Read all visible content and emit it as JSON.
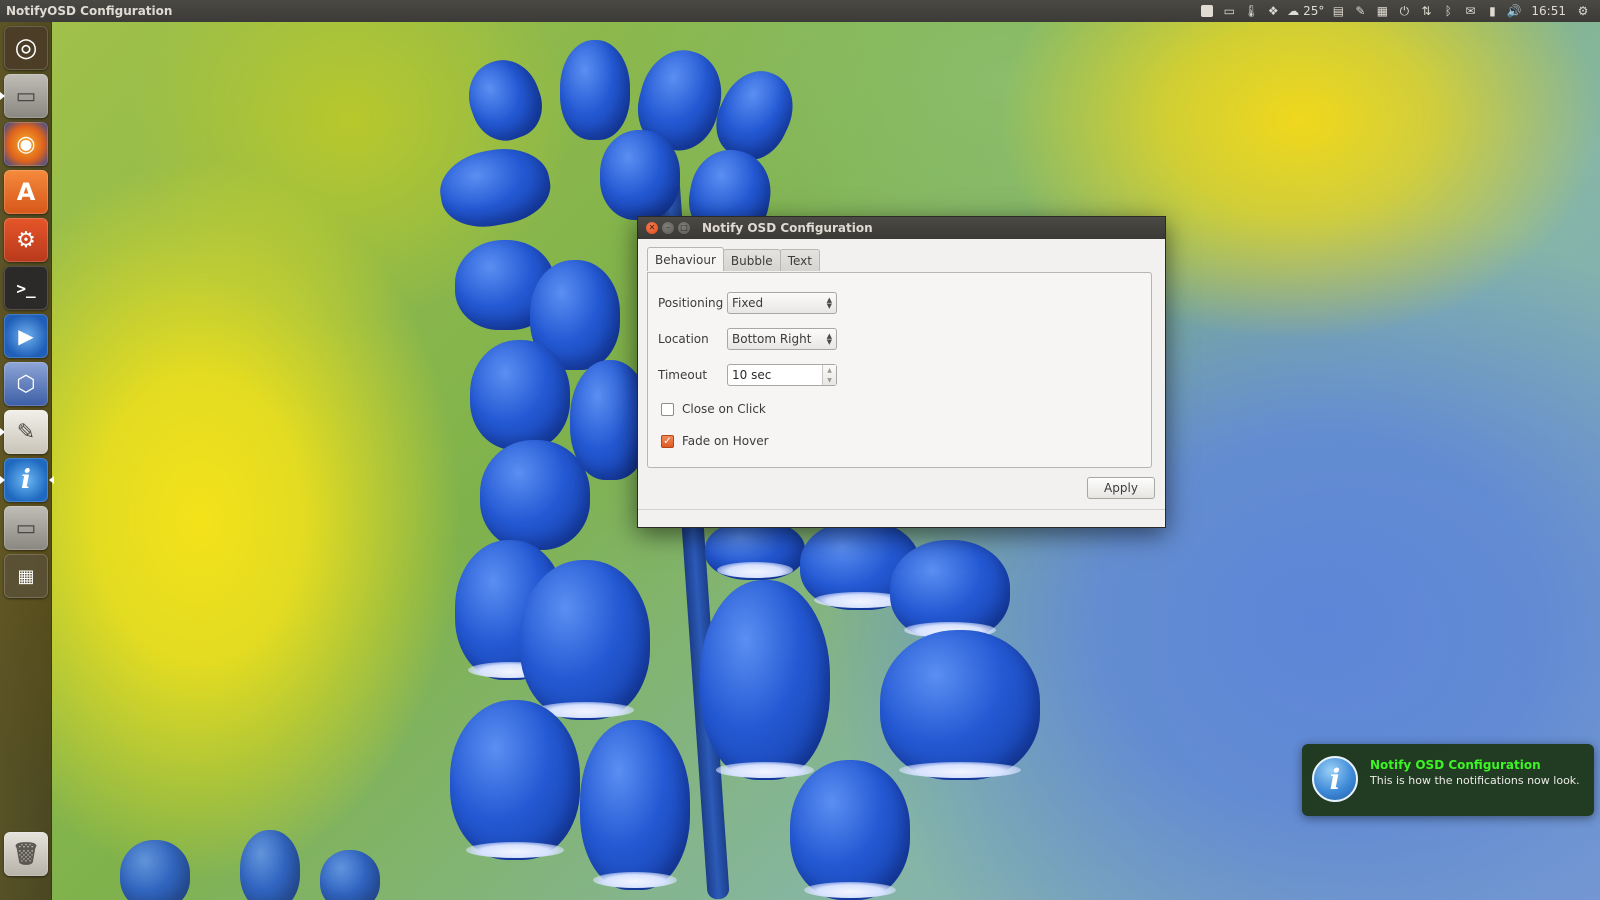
{
  "top_panel": {
    "app_title": "NotifyOSD Configuration",
    "indicators": [
      {
        "icon": "checkbox-indicator-icon"
      },
      {
        "icon": "keyboard-indicator-icon"
      },
      {
        "icon": "thermometer-icon"
      },
      {
        "icon": "dropbox-icon"
      },
      {
        "icon": "weather-icon",
        "label": "25°"
      },
      {
        "icon": "files-indicator-icon"
      },
      {
        "icon": "clipboard-icon"
      },
      {
        "icon": "calendar-icon"
      },
      {
        "icon": "power-indicator-icon"
      },
      {
        "icon": "network-icon"
      },
      {
        "icon": "bluetooth-icon"
      },
      {
        "icon": "mail-icon"
      },
      {
        "icon": "battery-icon"
      },
      {
        "icon": "volume-icon"
      }
    ],
    "clock": "16:51",
    "settings_icon": "gear-icon"
  },
  "launcher": {
    "items": [
      {
        "name": "dash-home",
        "icon": "ubuntu-logo-icon"
      },
      {
        "name": "file-manager",
        "icon": "drawer-icon"
      },
      {
        "name": "firefox",
        "icon": "firefox-icon"
      },
      {
        "name": "software-center",
        "icon": "software-center-icon"
      },
      {
        "name": "system-settings",
        "icon": "tools-icon"
      },
      {
        "name": "terminal",
        "icon": "terminal-icon",
        "glyph": ">_"
      },
      {
        "name": "media-player",
        "icon": "play-icon"
      },
      {
        "name": "virtualbox",
        "icon": "cube-icon"
      },
      {
        "name": "text-editor",
        "icon": "text-editor-icon"
      },
      {
        "name": "notify-osd-config",
        "icon": "info-icon"
      },
      {
        "name": "file-manager-2",
        "icon": "drawer-icon"
      },
      {
        "name": "workspace-switcher",
        "icon": "workspace-icon"
      },
      {
        "name": "trash",
        "icon": "trash-icon"
      }
    ]
  },
  "window": {
    "title": "Notify OSD Configuration",
    "tabs": [
      {
        "label": "Behaviour",
        "active": true
      },
      {
        "label": "Bubble",
        "active": false
      },
      {
        "label": "Text",
        "active": false
      }
    ],
    "positioning": {
      "label": "Positioning",
      "value": "Fixed"
    },
    "location": {
      "label": "Location",
      "value": "Bottom Right"
    },
    "timeout": {
      "label": "Timeout",
      "value": "10 sec"
    },
    "close_on_click": {
      "label": "Close on Click",
      "checked": false
    },
    "fade_on_hover": {
      "label": "Fade on Hover",
      "checked": true
    },
    "apply_label": "Apply"
  },
  "notification": {
    "title": "Notify OSD Configuration",
    "body": "This is how the notifications now look.",
    "icon": "info-icon"
  },
  "colors": {
    "accent_orange": "#dd5a22",
    "notification_title": "#3df524",
    "panel_bg": "#3c3b37"
  }
}
